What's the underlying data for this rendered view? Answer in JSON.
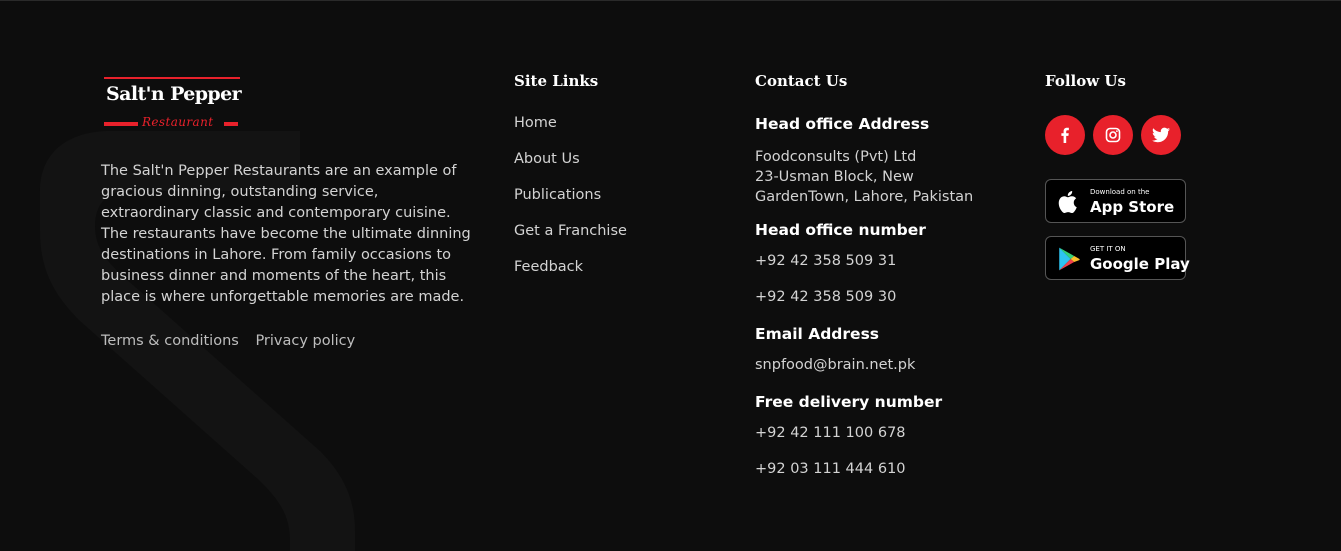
{
  "brand": {
    "name": "Salt'n Pepper",
    "subtitle": "Restaurant",
    "accent_color": "#e8212b"
  },
  "about": {
    "text": "The Salt'n Pepper Restaurants are an example of gracious dinning, outstanding service, extraordinary classic and contemporary cuisine. The restaurants have become the ultimate dinning destinations in Lahore. From family occasions to business dinner and moments of the heart, this place is where unforgettable memories are made."
  },
  "legal": {
    "terms": "Terms & conditions",
    "privacy": "Privacy policy"
  },
  "site_links": {
    "title": "Site Links",
    "items": [
      "Home",
      "About Us",
      "Publications",
      "Get a Franchise",
      "Feedback"
    ]
  },
  "contact": {
    "title": "Contact Us",
    "address_label": "Head office Address",
    "address_lines": [
      "Foodconsults (Pvt) Ltd",
      "23-Usman Block, New",
      "GardenTown, Lahore, Pakistan"
    ],
    "number_label": "Head office number",
    "numbers": [
      "+92 42 358 509 31",
      "+92 42 358 509 30"
    ],
    "email_label": "Email Address",
    "email": "snpfood@brain.net.pk",
    "delivery_label": "Free delivery number",
    "delivery_numbers": [
      "+92 42 111 100 678",
      "+92 03 111 444 610"
    ]
  },
  "follow": {
    "title": "Follow Us",
    "icons": [
      "facebook-icon",
      "instagram-icon",
      "twitter-icon"
    ]
  },
  "stores": {
    "app_store_small": "Download on the",
    "app_store_big": "App Store",
    "google_small": "GET IT ON",
    "google_big": "Google Play"
  }
}
